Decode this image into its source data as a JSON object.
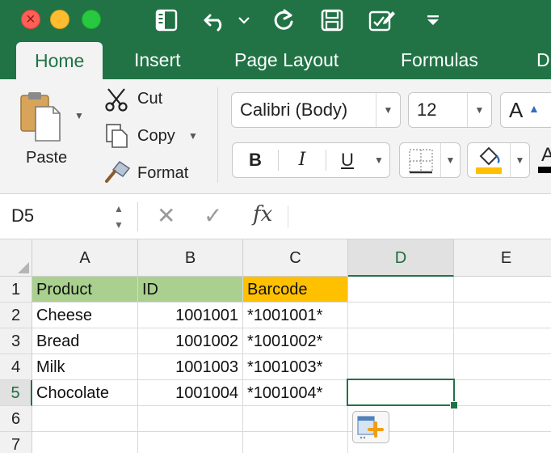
{
  "window": {
    "traffic_lights": [
      "close",
      "minimize",
      "maximize"
    ],
    "quick_access": [
      "sidebar-icon",
      "undo-icon",
      "redo-icon",
      "save-icon",
      "edit-icon",
      "customize-icon"
    ]
  },
  "ribbon_tabs": [
    {
      "label": "Home",
      "active": true
    },
    {
      "label": "Insert"
    },
    {
      "label": "Page Layout"
    },
    {
      "label": "Formulas"
    },
    {
      "label": "D"
    }
  ],
  "clipboard": {
    "paste_label": "Paste",
    "cut_label": "Cut",
    "copy_label": "Copy",
    "format_label": "Format"
  },
  "font": {
    "family": "Calibri (Body)",
    "size": "12",
    "bold": "B",
    "italic": "I",
    "underline": "U",
    "grow": "A",
    "color_label": "A"
  },
  "colors": {
    "accent": "#217346",
    "fill_yellow": "#ffc000",
    "header_green": "#a9d08e",
    "font_color": "#000000"
  },
  "formula_bar": {
    "name_box": "D5",
    "cancel": "✕",
    "enter": "✓",
    "fx": "fx",
    "content": ""
  },
  "sheet": {
    "columns": [
      "A",
      "B",
      "C",
      "D",
      "E"
    ],
    "selected_column": "D",
    "rows": [
      "1",
      "2",
      "3",
      "4",
      "5",
      "6",
      "7"
    ],
    "selected_row": "5",
    "selected_cell": "D5",
    "cells": [
      [
        "Product",
        "ID",
        "Barcode"
      ],
      [
        "Cheese",
        "1001001",
        "*1001001*"
      ],
      [
        "Bread",
        "1001002",
        "*1001002*"
      ],
      [
        "Milk",
        "1001003",
        "*1001003*"
      ],
      [
        "Chocolate",
        "1001004",
        "*1001004*"
      ]
    ]
  }
}
